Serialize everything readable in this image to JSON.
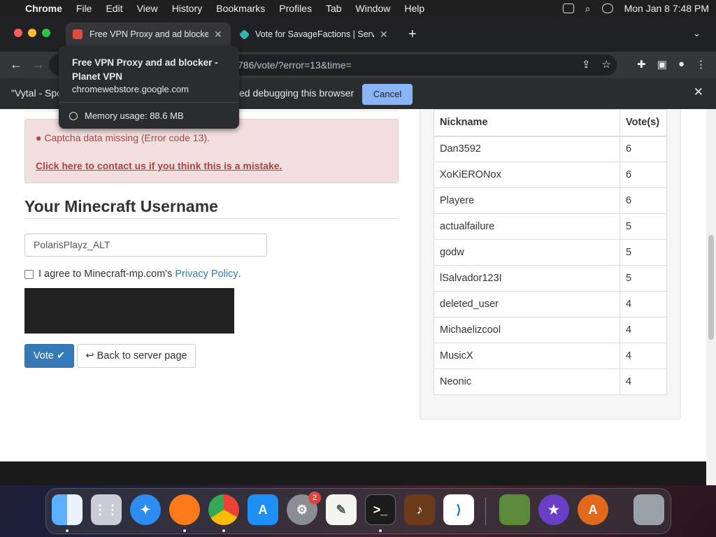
{
  "menubar": {
    "app_name": "Chrome",
    "items": [
      "File",
      "Edit",
      "View",
      "History",
      "Bookmarks",
      "Profiles",
      "Tab",
      "Window",
      "Help"
    ],
    "clock": "Mon Jan 8  7:48 PM"
  },
  "tabs": [
    {
      "title": "Free VPN Proxy and ad blocker",
      "favicon_color": "#e04a3f"
    },
    {
      "title": "Vote for SavageFactions | Serv",
      "favicon_color": "#2bb8b0"
    }
  ],
  "tab_tooltip": {
    "title": "Free VPN Proxy and ad blocker - Planet VPN",
    "domain": "chromewebstore.google.com",
    "memory": "Memory usage: 88.6 MB"
  },
  "omnibox": {
    "url_fragment": "786/vote/?error=13&time="
  },
  "infobar": {
    "left_text": "\"Vytal - Spo",
    "message": "ed debugging this browser",
    "cancel_label": "Cancel"
  },
  "alert": {
    "message": "Captcha data missing (Error code 13).",
    "link": "Click here to contact us if you think this is a mistake."
  },
  "form": {
    "heading": "Your Minecraft Username",
    "username_value": "PolarisPlayz_ALT",
    "agree_text": "I agree to Minecraft-mp.com's",
    "privacy_link": "Privacy Policy",
    "agree_suffix": ".",
    "vote_label": "Vote",
    "back_label": "Back to server page"
  },
  "votes_table": {
    "headers": [
      "Nickname",
      "Vote(s)"
    ],
    "rows": [
      [
        "Dan3592",
        "6"
      ],
      [
        "XoKiERONox",
        "6"
      ],
      [
        "Playere",
        "6"
      ],
      [
        "actualfailure",
        "5"
      ],
      [
        "godw",
        "5"
      ],
      [
        "lSalvador123I",
        "5"
      ],
      [
        "deleted_user",
        "4"
      ],
      [
        "Michaelizcool",
        "4"
      ],
      [
        "MusicX",
        "4"
      ],
      [
        "Neonic",
        "4"
      ]
    ]
  },
  "dock": {
    "apps": [
      "finder-icon",
      "launchpad-icon",
      "safari-icon",
      "firefox-icon",
      "chrome-icon",
      "app-store-icon",
      "system-settings-icon",
      "textedit-icon",
      "terminal-icon",
      "garageband-icon",
      "vscode-icon",
      "minecraft-icon",
      "imovie-icon",
      "app-icon",
      "trash-icon"
    ],
    "settings_badge": "2"
  },
  "colors": {
    "alert_bg": "#f2dede",
    "alert_text": "#a94442",
    "primary_button": "#337ab7",
    "infobar_cancel": "#8ab4f8"
  }
}
